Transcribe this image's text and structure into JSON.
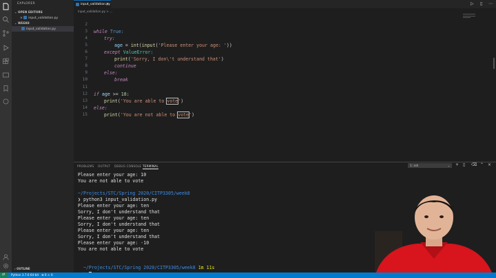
{
  "sidebar": {
    "title": "EXPLORER",
    "open_editors_label": "OPEN EDITORS",
    "folder_label": "WEEK8",
    "outline_label": "OUTLINE",
    "open_file": "input_validation.py",
    "folder_file": "input_validation.py"
  },
  "editor": {
    "tab_label": "input_validation.py",
    "breadcrumb": "input_validation.py > ...",
    "lines": [
      {
        "n": "2",
        "indent": 0
      },
      {
        "n": "3",
        "indent": 1
      },
      {
        "n": "4",
        "indent": 2
      },
      {
        "n": "5",
        "indent": 1
      },
      {
        "n": "6",
        "indent": 2
      },
      {
        "n": "7",
        "indent": 2
      },
      {
        "n": "8",
        "indent": 1
      },
      {
        "n": "9",
        "indent": 2
      },
      {
        "n": "10",
        "indent": 0
      },
      {
        "n": "11",
        "indent": 0
      },
      {
        "n": "12",
        "indent": 1
      },
      {
        "n": "13",
        "indent": 0
      },
      {
        "n": "14",
        "indent": 1
      },
      {
        "n": "15",
        "indent": 0
      }
    ],
    "code": {
      "l2_kw": "while",
      "l2_rest": " True:",
      "l3_kw": "try:",
      "l4_var": "age",
      "l4_eq": " = ",
      "l4_int": "int",
      "l4_input": "input",
      "l4_str": "'Please enter your age: '",
      "l5_kw": "except",
      "l5_exc": " ValueError:",
      "l6_print": "print",
      "l6_str": "'Sorry, I don\\'t understand that'",
      "l7_kw": "continue",
      "l8_kw": "else:",
      "l9_kw": "break",
      "l11_kw": "if",
      "l11_var": " age",
      "l11_op": " >= ",
      "l11_num": "18",
      "l11_colon": ":",
      "l12_print": "print",
      "l12_str_a": "'You are able to ",
      "l12_str_hl": "vote",
      "l12_str_b": "'",
      "l13_kw": "else:",
      "l14_print": "print",
      "l14_str_a": "'You are not able to ",
      "l14_str_hl": "vote",
      "l14_str_b": "'"
    }
  },
  "panel": {
    "tabs": [
      "PROBLEMS",
      "OUTPUT",
      "DEBUG CONSOLE",
      "TERMINAL"
    ],
    "active_tab": "TERMINAL",
    "shell": "1: zsh",
    "terminal_lines": [
      "Please enter your age: 10",
      "You are not able to vote",
      "",
      "~/Projects/STC/Spring 2020/CITP3305/week8",
      "❯ python3 input_validation.py",
      "Please enter your age: ten",
      "Sorry, I don't understand that",
      "Please enter your age: ten",
      "Sorry, I don't understand that",
      "Please enter your age: ten",
      "Sorry, I don't understand that",
      "Please enter your age: -10",
      "You are not able to vote",
      "",
      "~/Projects/STC/Spring 2020/CITP3305/week8",
      "❯"
    ],
    "last_path": "~/Projects/STC/Spring 2020/CITP3305/week8",
    "duration": "1m 11s"
  },
  "status": {
    "python": "Python 3.7.6 64-bit",
    "errors": "0",
    "warnings": "0"
  },
  "colors": {
    "accent": "#007acc",
    "editor_bg": "#1e1e1e",
    "sidebar_bg": "#252526",
    "activity_bg": "#333333"
  },
  "icons": [
    "files-icon",
    "search-icon",
    "source-control-icon",
    "run-debug-icon",
    "extensions-icon",
    "remote-icon",
    "bookmark-icon",
    "testing-icon",
    "accounts-icon",
    "settings-icon",
    "run-icon",
    "split-editor-icon",
    "more-icon"
  ]
}
